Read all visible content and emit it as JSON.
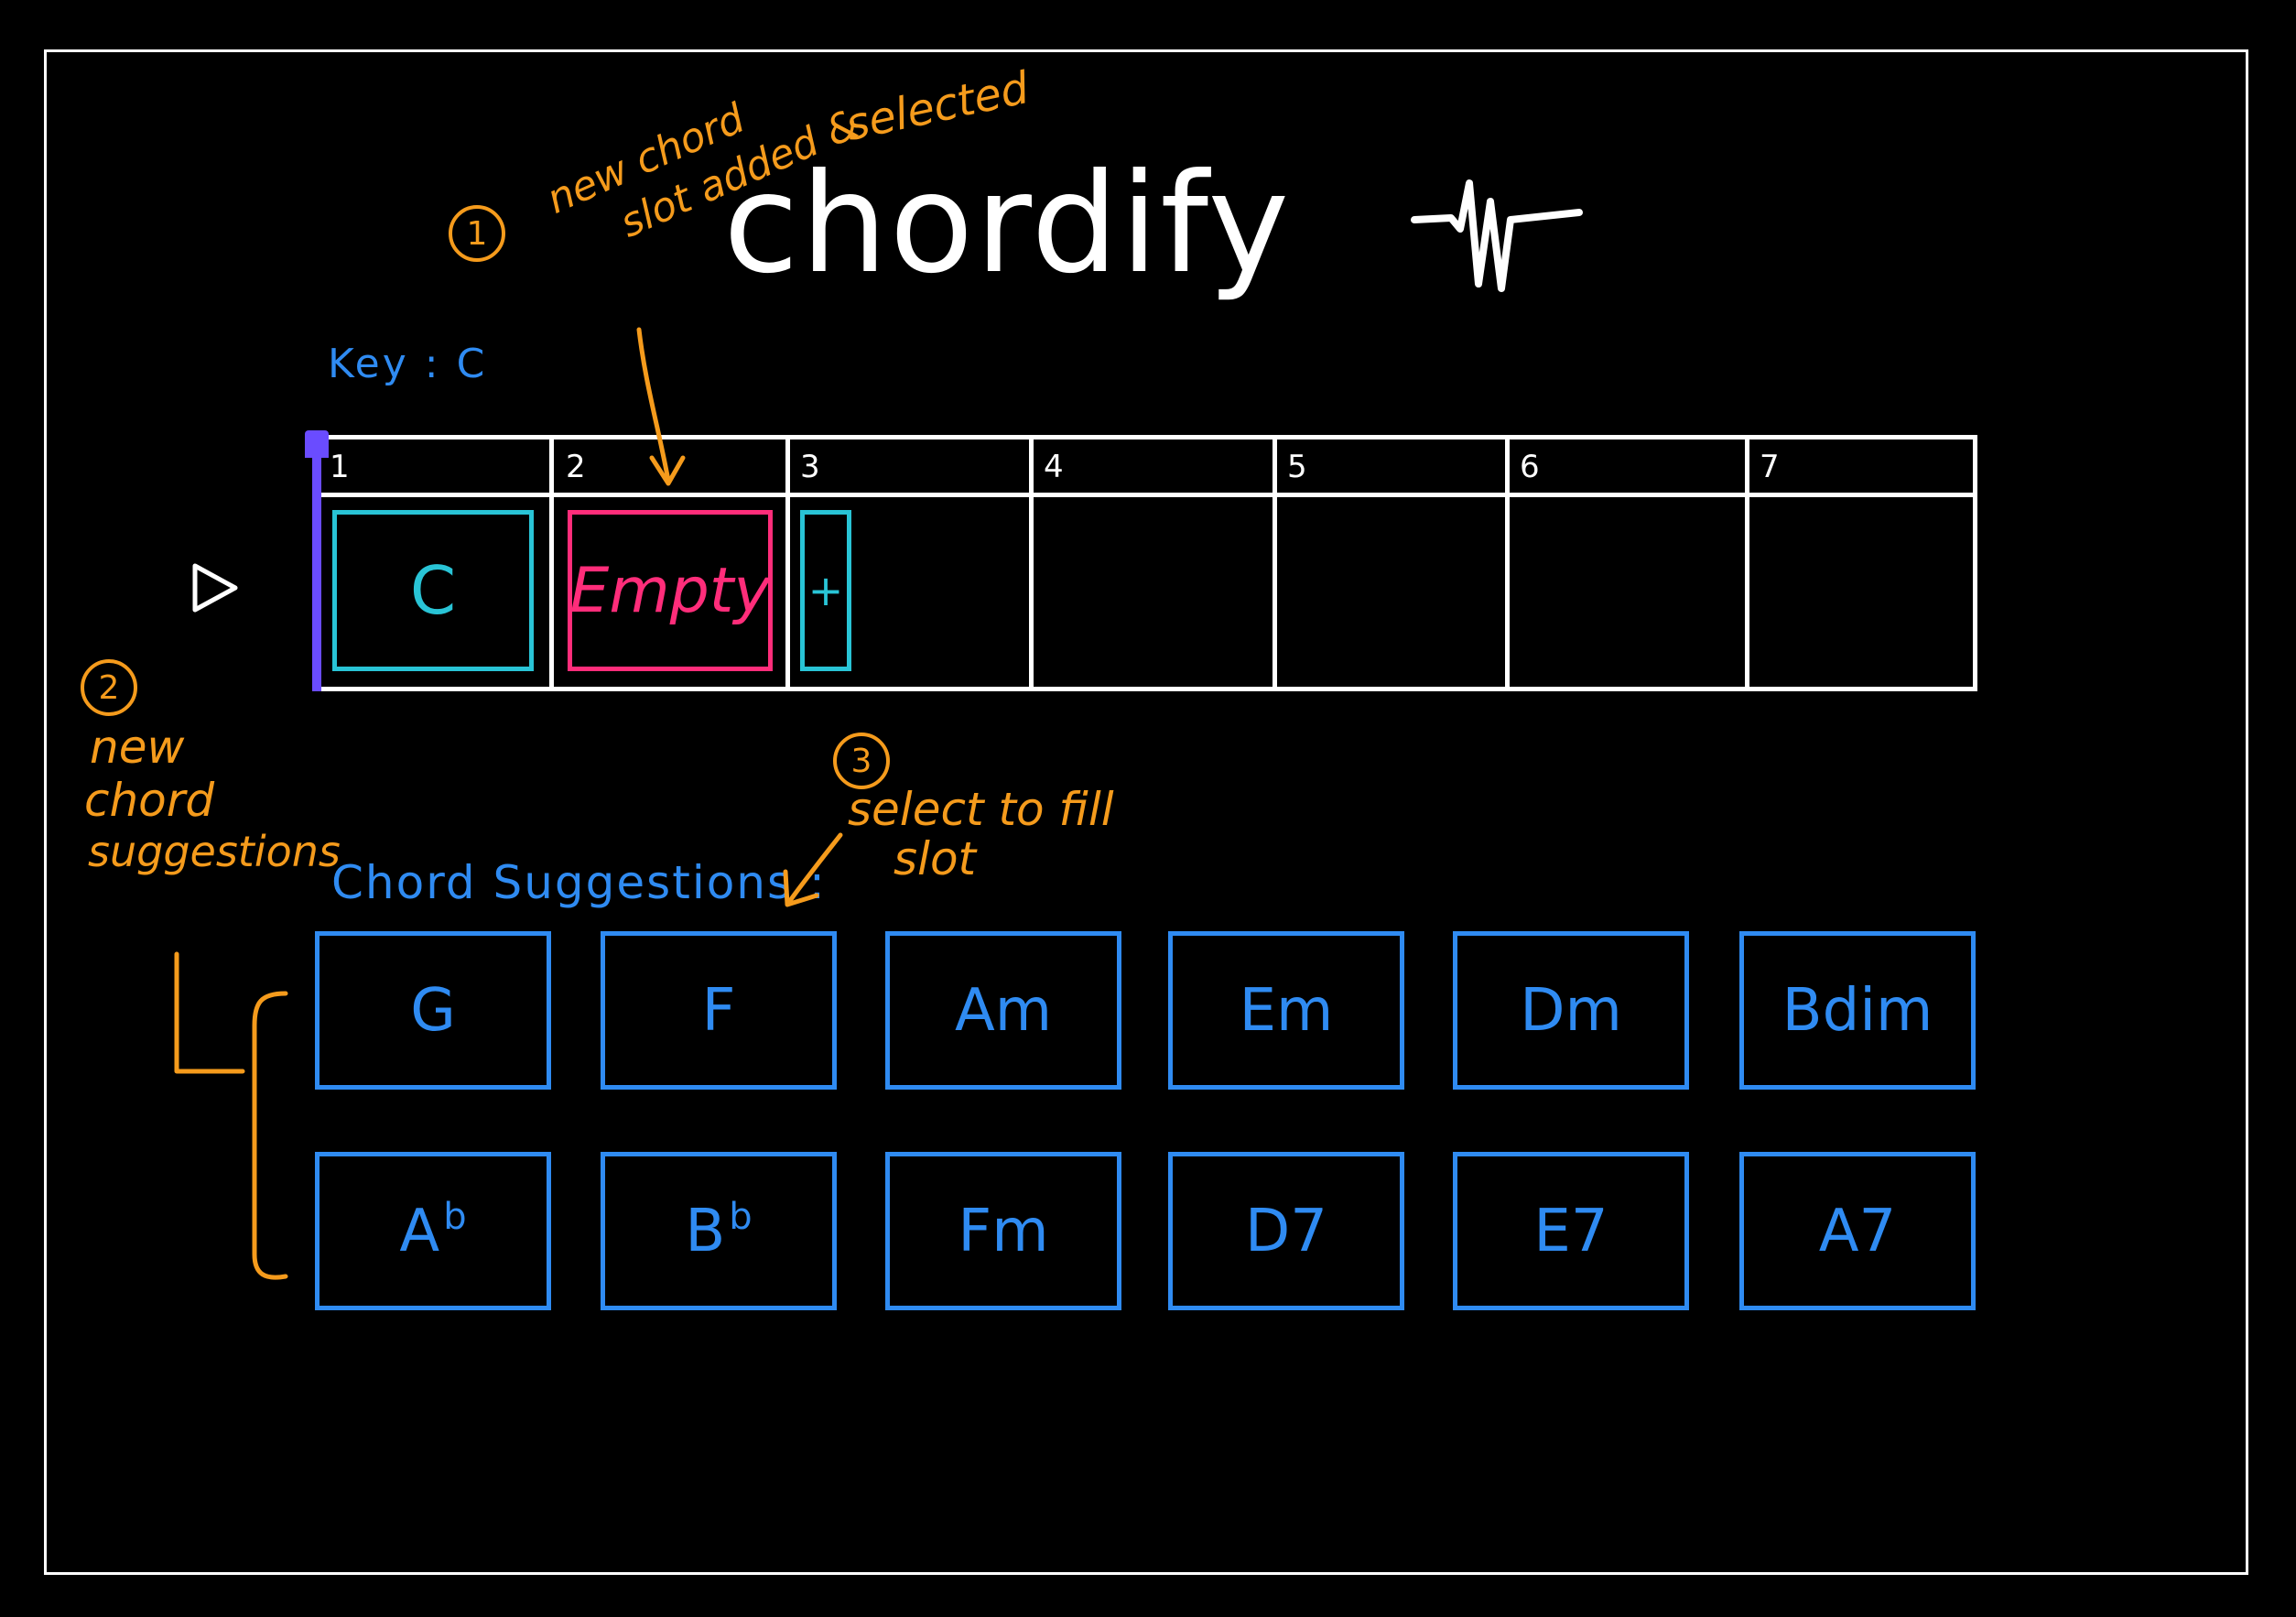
{
  "app": {
    "title": "chordify"
  },
  "key_label": "Key : C",
  "timeline": {
    "measures": [
      "1",
      "2",
      "3",
      "4",
      "5",
      "6",
      "7"
    ]
  },
  "slots": {
    "filled_chord": "C",
    "empty_label": "Empty",
    "add_label": "+"
  },
  "suggestions": {
    "label": "Chord Suggestions :",
    "row1": [
      "G",
      "F",
      "Am",
      "Em",
      "Dm",
      "Bdim"
    ],
    "row2": [
      {
        "root": "A",
        "accidental": "b"
      },
      {
        "root": "B",
        "accidental": "b"
      },
      {
        "root": "Fm",
        "accidental": ""
      },
      {
        "root": "D7",
        "accidental": ""
      },
      {
        "root": "E7",
        "accidental": ""
      },
      {
        "root": "A7",
        "accidental": ""
      }
    ]
  },
  "annotations": {
    "note1_number": "1",
    "note1_line1": "new chord",
    "note1_line2": "slot added &",
    "note1_line3": "selected",
    "note2_number": "2",
    "note2_line1": "new",
    "note2_line2": "chord",
    "note2_line3": "suggestions",
    "note3_number": "3",
    "note3_line1": "select to fill",
    "note3_line2": "slot"
  },
  "colors": {
    "background": "#000000",
    "frame": "#ffffff",
    "accent_blue": "#2f8bf2",
    "accent_cyan": "#29c4d6",
    "accent_pink": "#ff2d7a",
    "playhead": "#6a4cff",
    "annotation": "#f59b1c"
  },
  "icons": {
    "play": "play-icon",
    "pulse": "waveform-icon"
  }
}
